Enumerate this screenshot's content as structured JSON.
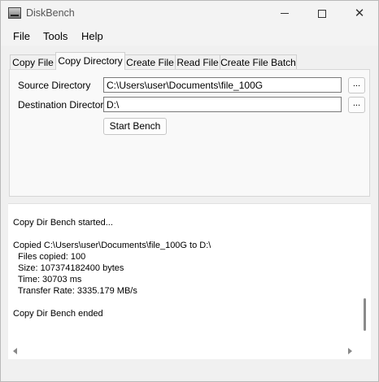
{
  "window": {
    "title": "DiskBench",
    "minimize_glyph": "",
    "close_glyph": "✕"
  },
  "menu": {
    "items": [
      "File",
      "Tools",
      "Help"
    ]
  },
  "tabs": [
    {
      "label": "Copy File",
      "active": false
    },
    {
      "label": "Copy Directory",
      "active": true
    },
    {
      "label": "Create File",
      "active": false
    },
    {
      "label": "Read File",
      "active": false
    },
    {
      "label": "Create File Batch",
      "active": false
    }
  ],
  "form": {
    "source_label": "Source Directory",
    "source_value": "C:\\Users\\user\\Documents\\file_100G",
    "dest_label": "Destination Directory",
    "dest_value": "D:\\",
    "browse_label": "...",
    "start_label": "Start Bench"
  },
  "log": {
    "lines": [
      "Copy Dir Bench started...",
      "",
      "Copied C:\\Users\\user\\Documents\\file_100G to D:\\",
      "  Files copied: 100",
      "  Size: 107374182400 bytes",
      "  Time: 30703 ms",
      "  Transfer Rate: 3335.179 MB/s",
      "",
      "Copy Dir Bench ended"
    ]
  }
}
